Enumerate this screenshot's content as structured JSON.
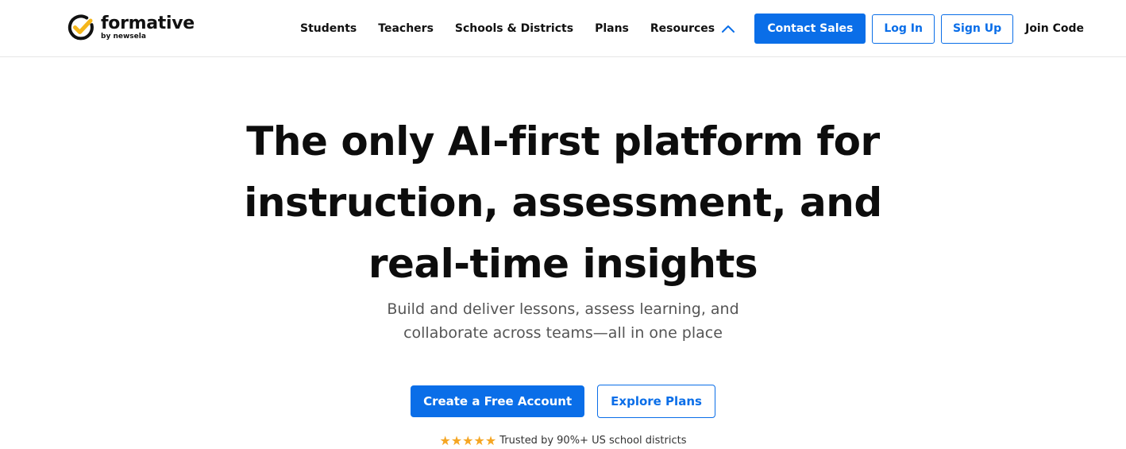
{
  "brand": {
    "name": "formative",
    "sub": "by newsela",
    "icon": "check-badge-icon",
    "colors": {
      "ring": "#111111",
      "check": "#f5b61a"
    }
  },
  "nav": {
    "items": [
      {
        "label": "Students"
      },
      {
        "label": "Teachers"
      },
      {
        "label": "Schools & Districts"
      },
      {
        "label": "Plans"
      },
      {
        "label": "Resources",
        "icon": "chevron-up-icon"
      }
    ]
  },
  "header_actions": {
    "contact_sales": "Contact Sales",
    "log_in": "Log In",
    "sign_up": "Sign Up",
    "join_code": "Join Code"
  },
  "hero": {
    "headline": "The only AI-first platform for instruction, assessment, and real-time insights",
    "subhead": "Build and deliver lessons, assess learning, and collaborate across teams—all in one place",
    "primary_cta": "Create a Free Account",
    "secondary_cta": "Explore Plans",
    "rating": {
      "stars": 5,
      "icon": "star-icon"
    },
    "trust_text": "Trusted by 90%+ US school districts"
  },
  "colors": {
    "accent": "#0a6ee8",
    "star": "#f5a623",
    "text": "#111111",
    "muted": "#555555"
  }
}
